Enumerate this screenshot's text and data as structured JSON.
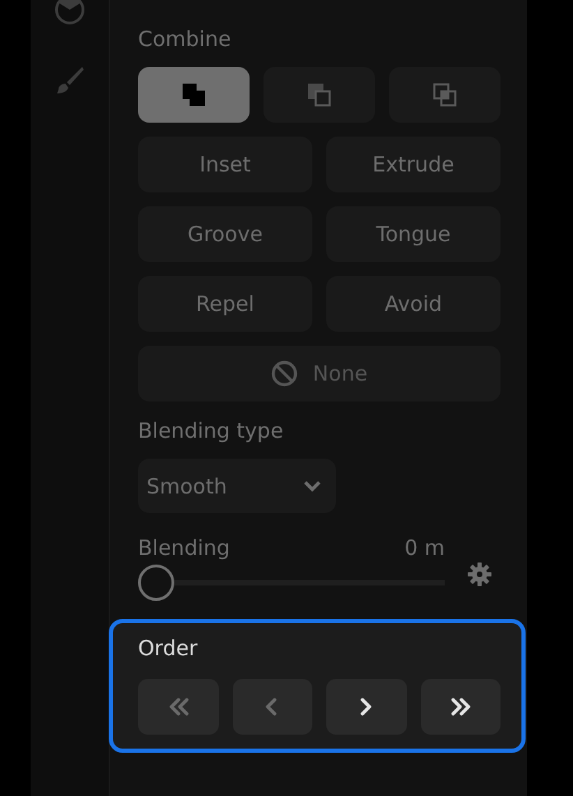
{
  "combine": {
    "label": "Combine",
    "options": [
      {
        "kind": "union",
        "selected": true
      },
      {
        "kind": "subtract",
        "selected": false
      },
      {
        "kind": "intersect",
        "selected": false
      }
    ]
  },
  "modes": [
    {
      "label": "Inset"
    },
    {
      "label": "Extrude"
    },
    {
      "label": "Groove"
    },
    {
      "label": "Tongue"
    },
    {
      "label": "Repel"
    },
    {
      "label": "Avoid"
    }
  ],
  "none_button": {
    "label": "None",
    "disabled": true
  },
  "blending_type": {
    "label": "Blending type",
    "value": "Smooth"
  },
  "blending": {
    "label": "Blending",
    "reading": "0 m",
    "level": 0
  },
  "order": {
    "label": "Order",
    "buttons": [
      {
        "kind": "first",
        "disabled": true
      },
      {
        "kind": "prev",
        "disabled": true
      },
      {
        "kind": "next",
        "disabled": false
      },
      {
        "kind": "last",
        "disabled": false
      }
    ]
  }
}
